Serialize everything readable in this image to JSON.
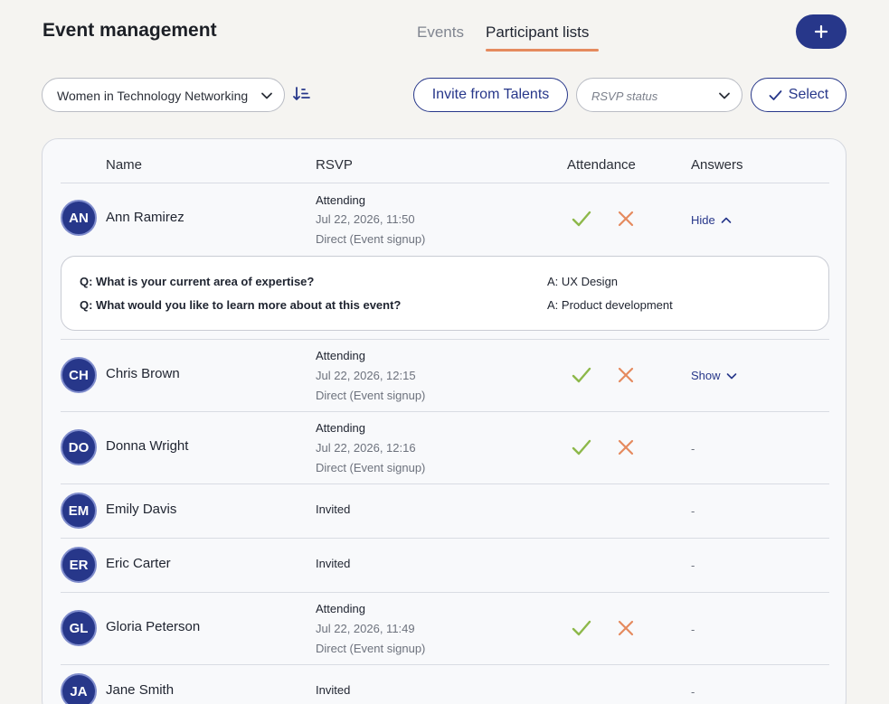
{
  "header": {
    "title": "Event management",
    "tabs": [
      {
        "label": "Events",
        "active": false
      },
      {
        "label": "Participant lists",
        "active": true
      }
    ],
    "add_icon": "plus-icon"
  },
  "toolbar": {
    "event_select_value": "Women in Technology Networking",
    "sort_icon": "sort-descending-icon",
    "invite_label": "Invite from Talents",
    "rsvp_placeholder": "RSVP status",
    "select_label": "Select"
  },
  "table": {
    "columns": [
      "Name",
      "RSVP",
      "Attendance",
      "Answers"
    ],
    "rows": [
      {
        "initials": "AN",
        "name": "Ann Ramirez",
        "rsvp": "Attending",
        "date": "Jul 22, 2026, 11:50",
        "source": "Direct (Event signup)",
        "answers": "Hide"
      },
      {
        "initials": "CH",
        "name": "Chris Brown",
        "rsvp": "Attending",
        "date": "Jul 22, 2026, 12:15",
        "source": "Direct (Event signup)",
        "answers": "Show"
      },
      {
        "initials": "DO",
        "name": "Donna Wright",
        "rsvp": "Attending",
        "date": "Jul 22, 2026, 12:16",
        "source": "Direct (Event signup)",
        "answers": "-"
      },
      {
        "initials": "EM",
        "name": "Emily Davis",
        "rsvp": "Invited",
        "answers": "-"
      },
      {
        "initials": "ER",
        "name": "Eric Carter",
        "rsvp": "Invited",
        "answers": "-"
      },
      {
        "initials": "GL",
        "name": "Gloria Peterson",
        "rsvp": "Attending",
        "date": "Jul 22, 2026, 11:49",
        "source": "Direct (Event signup)",
        "answers": "-"
      },
      {
        "initials": "JA",
        "name": "Jane Smith",
        "rsvp": "Invited",
        "answers": "-"
      }
    ]
  },
  "answers_panel": {
    "items": [
      {
        "q": "Q: What is your current area of expertise?",
        "a": "A: UX Design"
      },
      {
        "q": "Q: What would you like to learn more about at this event?",
        "a": "A: Product development"
      }
    ]
  },
  "colors": {
    "accent": "#27378a",
    "tab_underline": "#e58a5e",
    "check": "#8db84a",
    "cross": "#e58a5e"
  }
}
